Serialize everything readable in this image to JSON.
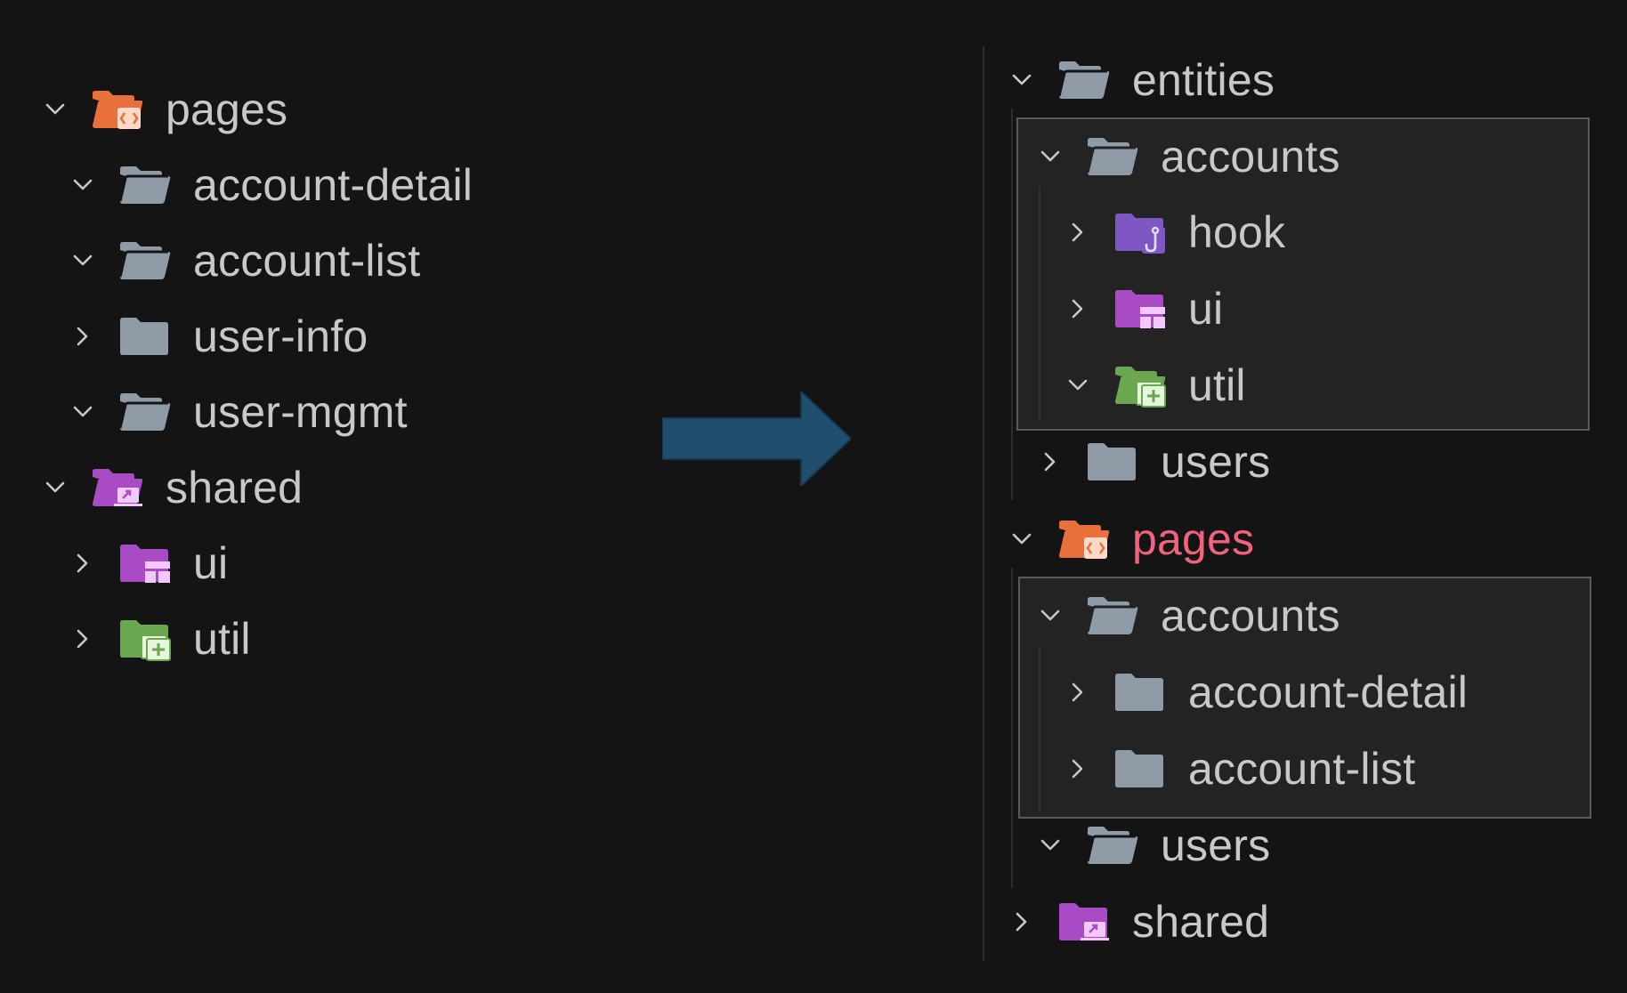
{
  "left_tree": {
    "items": [
      {
        "label": "pages",
        "expanded": true,
        "icon": "folder-pages-icon"
      },
      {
        "label": "account-detail",
        "expanded": true,
        "icon": "folder-open-icon"
      },
      {
        "label": "account-list",
        "expanded": true,
        "icon": "folder-open-icon"
      },
      {
        "label": "user-info",
        "expanded": false,
        "icon": "folder-closed-icon"
      },
      {
        "label": "user-mgmt",
        "expanded": true,
        "icon": "folder-open-icon"
      },
      {
        "label": "shared",
        "expanded": true,
        "icon": "folder-shared-icon"
      },
      {
        "label": "ui",
        "expanded": false,
        "icon": "folder-ui-icon"
      },
      {
        "label": "util",
        "expanded": false,
        "icon": "folder-util-icon"
      }
    ]
  },
  "right_tree": {
    "items": [
      {
        "label": "entities",
        "expanded": true,
        "icon": "folder-open-icon"
      },
      {
        "label": "accounts",
        "expanded": true,
        "icon": "folder-open-icon"
      },
      {
        "label": "hook",
        "expanded": false,
        "icon": "folder-hook-icon"
      },
      {
        "label": "ui",
        "expanded": false,
        "icon": "folder-ui-icon"
      },
      {
        "label": "util",
        "expanded": true,
        "icon": "folder-util-icon"
      },
      {
        "label": "users",
        "expanded": false,
        "icon": "folder-closed-icon"
      },
      {
        "label": "pages",
        "expanded": true,
        "icon": "folder-pages-icon",
        "highlight": true
      },
      {
        "label": "accounts",
        "expanded": true,
        "icon": "folder-open-icon"
      },
      {
        "label": "account-detail",
        "expanded": false,
        "icon": "folder-closed-icon"
      },
      {
        "label": "account-list",
        "expanded": false,
        "icon": "folder-closed-icon"
      },
      {
        "label": "users",
        "expanded": true,
        "icon": "folder-open-icon"
      },
      {
        "label": "shared",
        "expanded": false,
        "icon": "folder-shared-icon"
      }
    ]
  },
  "colors": {
    "background": "#141414",
    "text": "#c8c8c8",
    "highlight_text": "#f0637a",
    "folder_gray": "#8f9ba6",
    "pages_orange": "#e8703a",
    "shared_purple": "#a94bc4",
    "hook_purple": "#7e57c2",
    "util_green": "#6aa84f",
    "arrow": "#1f4e6e"
  },
  "arrow_icon": "arrow-right-icon"
}
